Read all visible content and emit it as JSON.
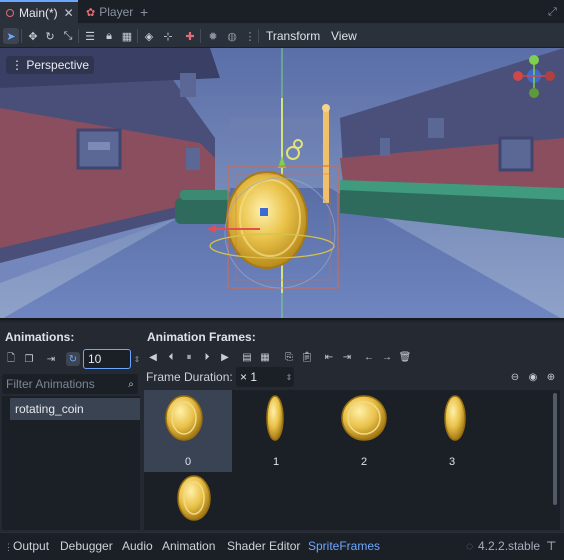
{
  "tabs": [
    {
      "label": "Main(*)",
      "active": true
    },
    {
      "label": "Player",
      "active": false
    }
  ],
  "toolbar": {
    "menus": [
      "Transform",
      "View"
    ],
    "icons": [
      "select-icon",
      "move-icon",
      "rotate-icon",
      "scale-icon",
      "list-icon",
      "lock-icon",
      "group-icon",
      "ruler-icon",
      "snap-icon",
      "sun-icon",
      "environment-icon",
      "camera-icon",
      "transform-icon"
    ]
  },
  "viewport": {
    "mode_label": "Perspective"
  },
  "animations": {
    "header": "Animations:",
    "speed_value": "10",
    "filter_placeholder": "Filter Animations",
    "items": [
      "rotating_coin"
    ]
  },
  "frames_panel": {
    "header": "Animation Frames:",
    "duration_label": "Frame Duration:",
    "duration_value": "× 1",
    "frames": [
      {
        "label": "0",
        "selected": true,
        "coin_width_ratio": 1.0
      },
      {
        "label": "1",
        "selected": false,
        "coin_width_ratio": 0.4
      },
      {
        "label": "2",
        "selected": false,
        "coin_width_ratio": 1.0
      },
      {
        "label": "3",
        "selected": false,
        "coin_width_ratio": 0.45
      },
      {
        "label": "",
        "selected": false,
        "coin_width_ratio": 0.8
      }
    ]
  },
  "status_bar": {
    "tabs": [
      "Output",
      "Debugger",
      "Audio",
      "Animation",
      "Shader Editor",
      "SpriteFrames"
    ],
    "active_tab": "SpriteFrames",
    "version": "4.2.2.stable"
  },
  "colors": {
    "accent": "#6ea7ff",
    "coin_gold": "#e9c24a",
    "panel_bg": "#242932"
  }
}
